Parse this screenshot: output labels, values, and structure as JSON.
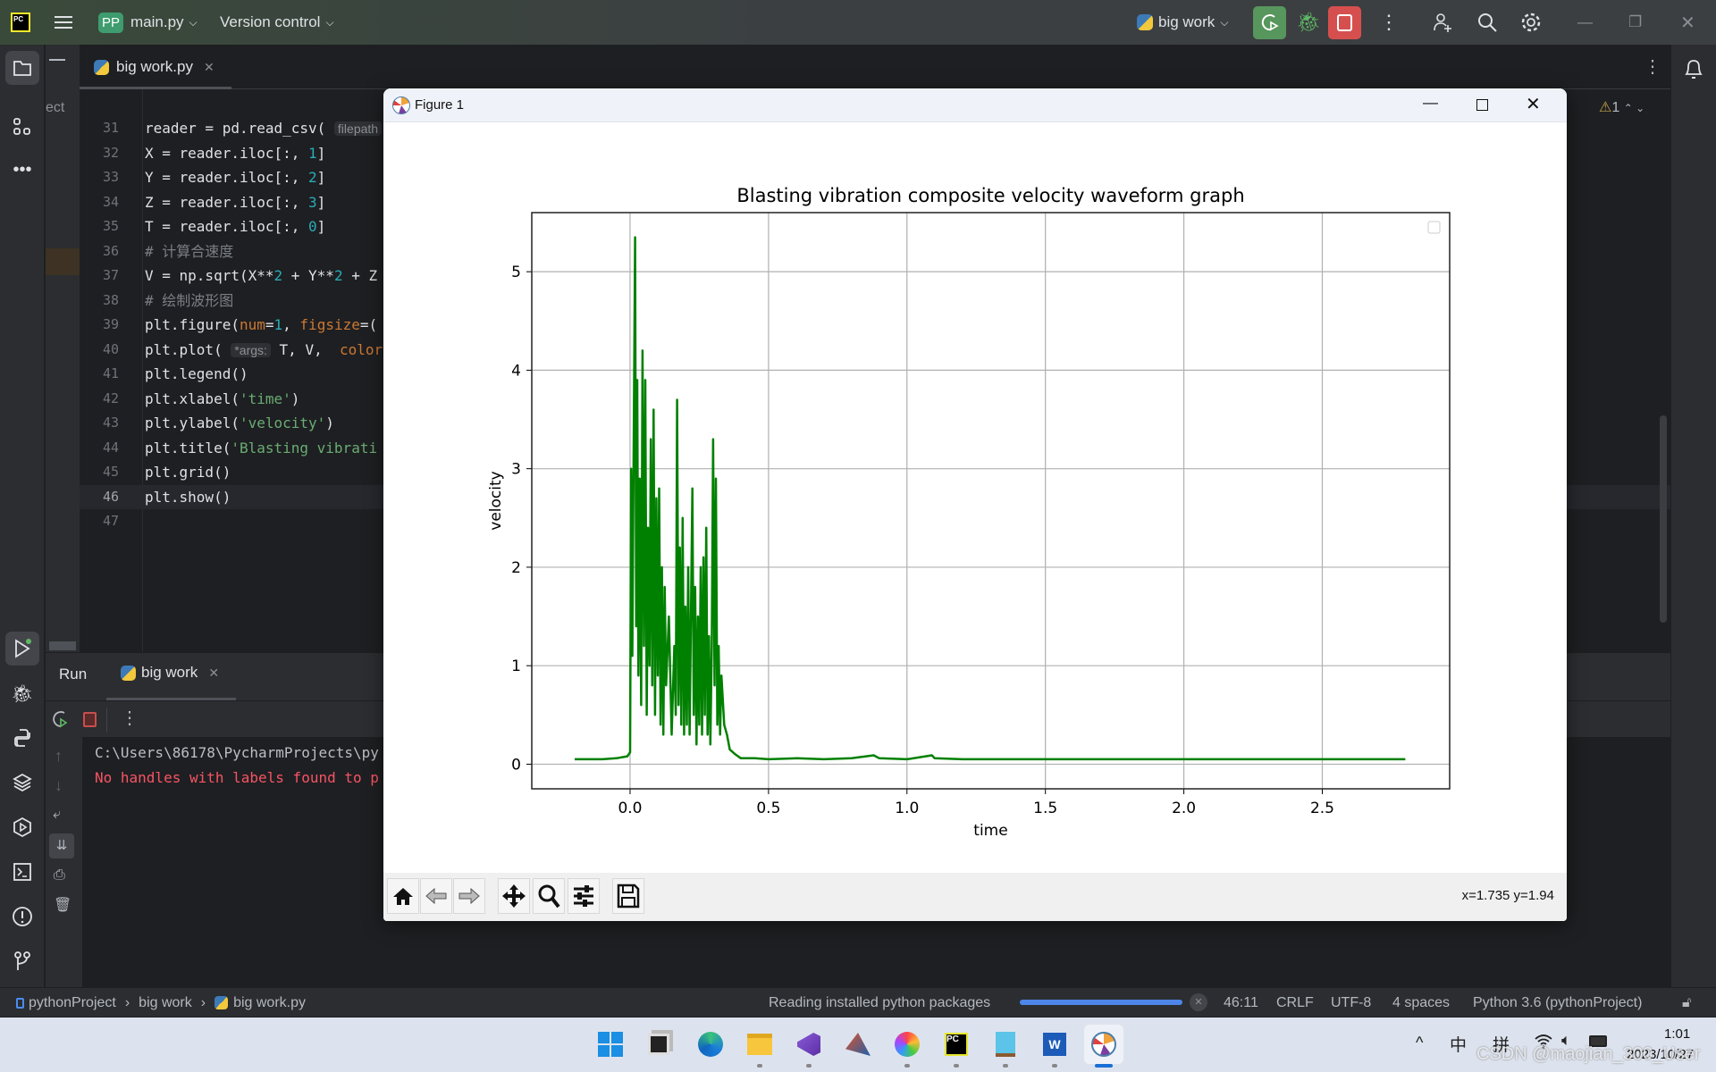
{
  "titlebar": {
    "project_badge": "PP",
    "project_name": "main.py",
    "vcs": "Version control",
    "run_config": "big work"
  },
  "editor": {
    "tab": "big work.py",
    "project_panel_fragment": "ect",
    "warning_count": "1",
    "lines": [
      {
        "n": "31",
        "t": [
          [
            "reader = pd.read_csv( ",
            ""
          ],
          [
            "filepath",
            "k-hint"
          ]
        ]
      },
      {
        "n": "32",
        "t": [
          [
            "X = reader.iloc[:, ",
            ""
          ],
          [
            "1",
            "k-num"
          ],
          [
            "]",
            ""
          ]
        ]
      },
      {
        "n": "33",
        "t": [
          [
            "Y = reader.iloc[:, ",
            ""
          ],
          [
            "2",
            "k-num"
          ],
          [
            "]",
            ""
          ]
        ]
      },
      {
        "n": "34",
        "t": [
          [
            "Z = reader.iloc[:, ",
            ""
          ],
          [
            "3",
            "k-num"
          ],
          [
            "]",
            ""
          ]
        ]
      },
      {
        "n": "35",
        "t": [
          [
            "T = reader.iloc[:, ",
            ""
          ],
          [
            "0",
            "k-num"
          ],
          [
            "]",
            ""
          ]
        ]
      },
      {
        "n": "36",
        "t": [
          [
            "# 计算合速度",
            "k-cmt"
          ]
        ]
      },
      {
        "n": "37",
        "t": [
          [
            "V = np.sqrt(X**",
            ""
          ],
          [
            "2",
            "k-num"
          ],
          [
            " + Y**",
            ""
          ],
          [
            "2",
            "k-num"
          ],
          [
            " + Z",
            ""
          ]
        ]
      },
      {
        "n": "38",
        "t": [
          [
            "# 绘制波形图",
            "k-cmt"
          ]
        ]
      },
      {
        "n": "39",
        "t": [
          [
            "plt.figure(",
            ""
          ],
          [
            "num",
            "k-kw"
          ],
          [
            "=",
            ""
          ],
          [
            "1",
            "k-num"
          ],
          [
            ", ",
            ""
          ],
          [
            "figsize",
            "k-kw"
          ],
          [
            "=(",
            ""
          ]
        ]
      },
      {
        "n": "40",
        "t": [
          [
            "plt.plot( ",
            ""
          ],
          [
            "*args:",
            "k-hint"
          ],
          [
            " T, V,  ",
            ""
          ],
          [
            "color",
            "k-kw"
          ]
        ]
      },
      {
        "n": "41",
        "t": [
          [
            "plt.legend()",
            ""
          ]
        ]
      },
      {
        "n": "42",
        "t": [
          [
            "plt.xlabel(",
            ""
          ],
          [
            "'time'",
            "k-str"
          ],
          [
            ")",
            ""
          ]
        ]
      },
      {
        "n": "43",
        "t": [
          [
            "plt.ylabel(",
            ""
          ],
          [
            "'velocity'",
            "k-str"
          ],
          [
            ")",
            ""
          ]
        ]
      },
      {
        "n": "44",
        "t": [
          [
            "plt.title(",
            ""
          ],
          [
            "'Blasting vibrati",
            "k-str"
          ]
        ]
      },
      {
        "n": "45",
        "t": [
          [
            "plt.grid()",
            ""
          ]
        ]
      },
      {
        "n": "46",
        "t": [
          [
            "plt.show()",
            ""
          ]
        ]
      },
      {
        "n": "47",
        "t": []
      }
    ],
    "current_line": "46"
  },
  "run": {
    "tab_run": "Run",
    "tab_config": "big work",
    "console": [
      {
        "text": "C:\\Users\\86178\\PycharmProjects\\py",
        "color": "#bcbec4"
      },
      {
        "text": "No handles with labels found to p",
        "color": "#f75464"
      }
    ]
  },
  "statusbar": {
    "breadcrumb": [
      "pythonProject",
      "big work",
      "big work.py"
    ],
    "task": "Reading installed python packages",
    "task_progress": 1.0,
    "position": "46:11",
    "line_sep": "CRLF",
    "encoding": "UTF-8",
    "indent": "4 spaces",
    "interpreter": "Python 3.6 (pythonProject)"
  },
  "figure": {
    "window_title": "Figure 1",
    "coords": "x=1.735 y=1.94"
  },
  "chart_data": {
    "type": "line",
    "title": "Blasting vibration composite velocity waveform graph",
    "xlabel": "time",
    "ylabel": "velocity",
    "xlim": [
      -0.355,
      2.96
    ],
    "ylim": [
      -0.25,
      5.6
    ],
    "xticks": [
      "0.0",
      "0.5",
      "1.0",
      "1.5",
      "2.0",
      "2.5"
    ],
    "yticks": [
      "0",
      "1",
      "2",
      "3",
      "4",
      "5"
    ],
    "grid": true,
    "legend": "top-right (empty)",
    "color": "#008000",
    "series": [
      {
        "x": [
          -0.2,
          -0.15,
          -0.1,
          -0.05,
          -0.01,
          0.0,
          0.004,
          0.008,
          0.012,
          0.018,
          0.022,
          0.026,
          0.03,
          0.035,
          0.04,
          0.045,
          0.05,
          0.055,
          0.06,
          0.065,
          0.07,
          0.075,
          0.08,
          0.085,
          0.09,
          0.095,
          0.1,
          0.105,
          0.11,
          0.115,
          0.12,
          0.125,
          0.13,
          0.14,
          0.15,
          0.16,
          0.165,
          0.17,
          0.175,
          0.18,
          0.185,
          0.19,
          0.195,
          0.2,
          0.205,
          0.21,
          0.215,
          0.22,
          0.225,
          0.23,
          0.235,
          0.24,
          0.245,
          0.25,
          0.255,
          0.26,
          0.265,
          0.27,
          0.275,
          0.28,
          0.285,
          0.29,
          0.295,
          0.3,
          0.305,
          0.31,
          0.315,
          0.32,
          0.325,
          0.33,
          0.34,
          0.35,
          0.36,
          0.38,
          0.4,
          0.45,
          0.5,
          0.6,
          0.7,
          0.8,
          0.88,
          0.9,
          1.0,
          1.09,
          1.1,
          1.2,
          1.4,
          1.6,
          1.8,
          2.0,
          2.2,
          2.4,
          2.6,
          2.8
        ],
        "y": [
          0.05,
          0.05,
          0.05,
          0.06,
          0.08,
          0.12,
          3.0,
          1.1,
          2.8,
          5.35,
          1.4,
          3.9,
          0.9,
          2.9,
          0.6,
          4.2,
          1.2,
          3.9,
          0.5,
          2.4,
          1.0,
          3.3,
          0.8,
          3.6,
          0.5,
          2.7,
          0.9,
          2.8,
          0.4,
          2.0,
          0.3,
          1.8,
          0.8,
          1.5,
          0.3,
          1.2,
          0.5,
          3.7,
          0.6,
          2.2,
          0.4,
          2.5,
          0.3,
          1.6,
          0.4,
          2.0,
          0.3,
          1.5,
          2.8,
          0.5,
          1.8,
          0.2,
          1.5,
          0.4,
          2.0,
          0.3,
          2.1,
          0.5,
          2.4,
          0.3,
          1.3,
          0.2,
          1.2,
          3.3,
          0.8,
          2.9,
          0.4,
          1.2,
          0.3,
          0.9,
          0.4,
          0.3,
          0.15,
          0.1,
          0.06,
          0.06,
          0.05,
          0.06,
          0.05,
          0.06,
          0.09,
          0.06,
          0.05,
          0.09,
          0.06,
          0.05,
          0.05,
          0.05,
          0.05,
          0.05,
          0.05,
          0.05,
          0.05,
          0.05
        ]
      }
    ]
  },
  "taskbar": {
    "apps": [
      "start",
      "task-view",
      "edge",
      "file-explorer",
      "visual-studio",
      "matlab",
      "color-app",
      "pycharm",
      "notepad",
      "word",
      "matplotlib-figure"
    ],
    "tray_ime1": "中",
    "tray_ime2": "拼",
    "time": "1:01",
    "date": "2023/10/27",
    "watermark": "CSDN @maojian_300_User"
  }
}
